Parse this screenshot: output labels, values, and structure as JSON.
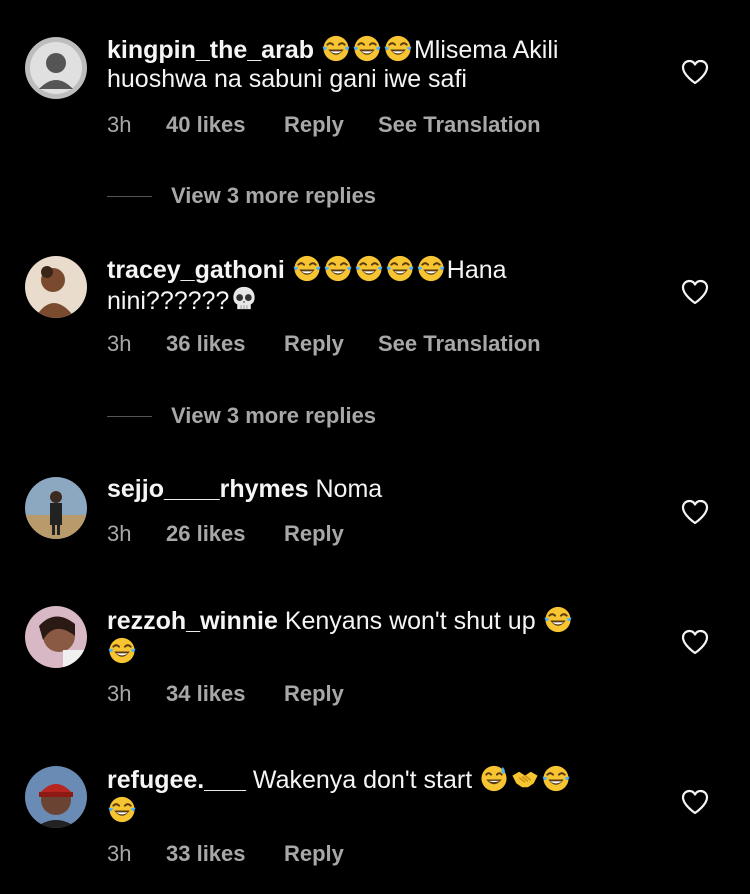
{
  "heart_icon": "heart-outline-icon",
  "colors": {
    "background": "#000000",
    "text": "#f5f5f5",
    "muted": "#a8a8a8"
  },
  "comments": [
    {
      "username": "kingpin_the_arab",
      "emojis": [
        "face-with-tears-of-joy",
        "face-with-tears-of-joy",
        "face-with-tears-of-joy"
      ],
      "text": "Mlisema Akili huoshwa na sabuni gani iwe safi",
      "time": "3h",
      "likes": "40 likes",
      "reply": "Reply",
      "translate": "See Translation",
      "view_more": "View 3 more replies"
    },
    {
      "username": "tracey_gathoni",
      "emojis": [
        "face-with-tears-of-joy",
        "face-with-tears-of-joy",
        "face-with-tears-of-joy",
        "face-with-tears-of-joy",
        "face-with-tears-of-joy"
      ],
      "text": "Hana nini??????",
      "trailing_emoji": "skull",
      "time": "3h",
      "likes": "36 likes",
      "reply": "Reply",
      "translate": "See Translation",
      "view_more": "View 3 more replies"
    },
    {
      "username": "sejjo____rhymes",
      "text": "Noma",
      "time": "3h",
      "likes": "26 likes",
      "reply": "Reply"
    },
    {
      "username": "rezzoh_winnie",
      "text": "Kenyans won't shut up",
      "trailing_emojis": [
        "face-with-tears-of-joy",
        "face-with-tears-of-joy"
      ],
      "time": "3h",
      "likes": "34 likes",
      "reply": "Reply"
    },
    {
      "username": "refugee.___",
      "text": "Wakenya don't start",
      "trailing_emojis": [
        "grinning-face-with-sweat",
        "handshake",
        "face-with-tears-of-joy",
        "face-with-tears-of-joy"
      ],
      "time": "3h",
      "likes": "33 likes",
      "reply": "Reply"
    }
  ]
}
